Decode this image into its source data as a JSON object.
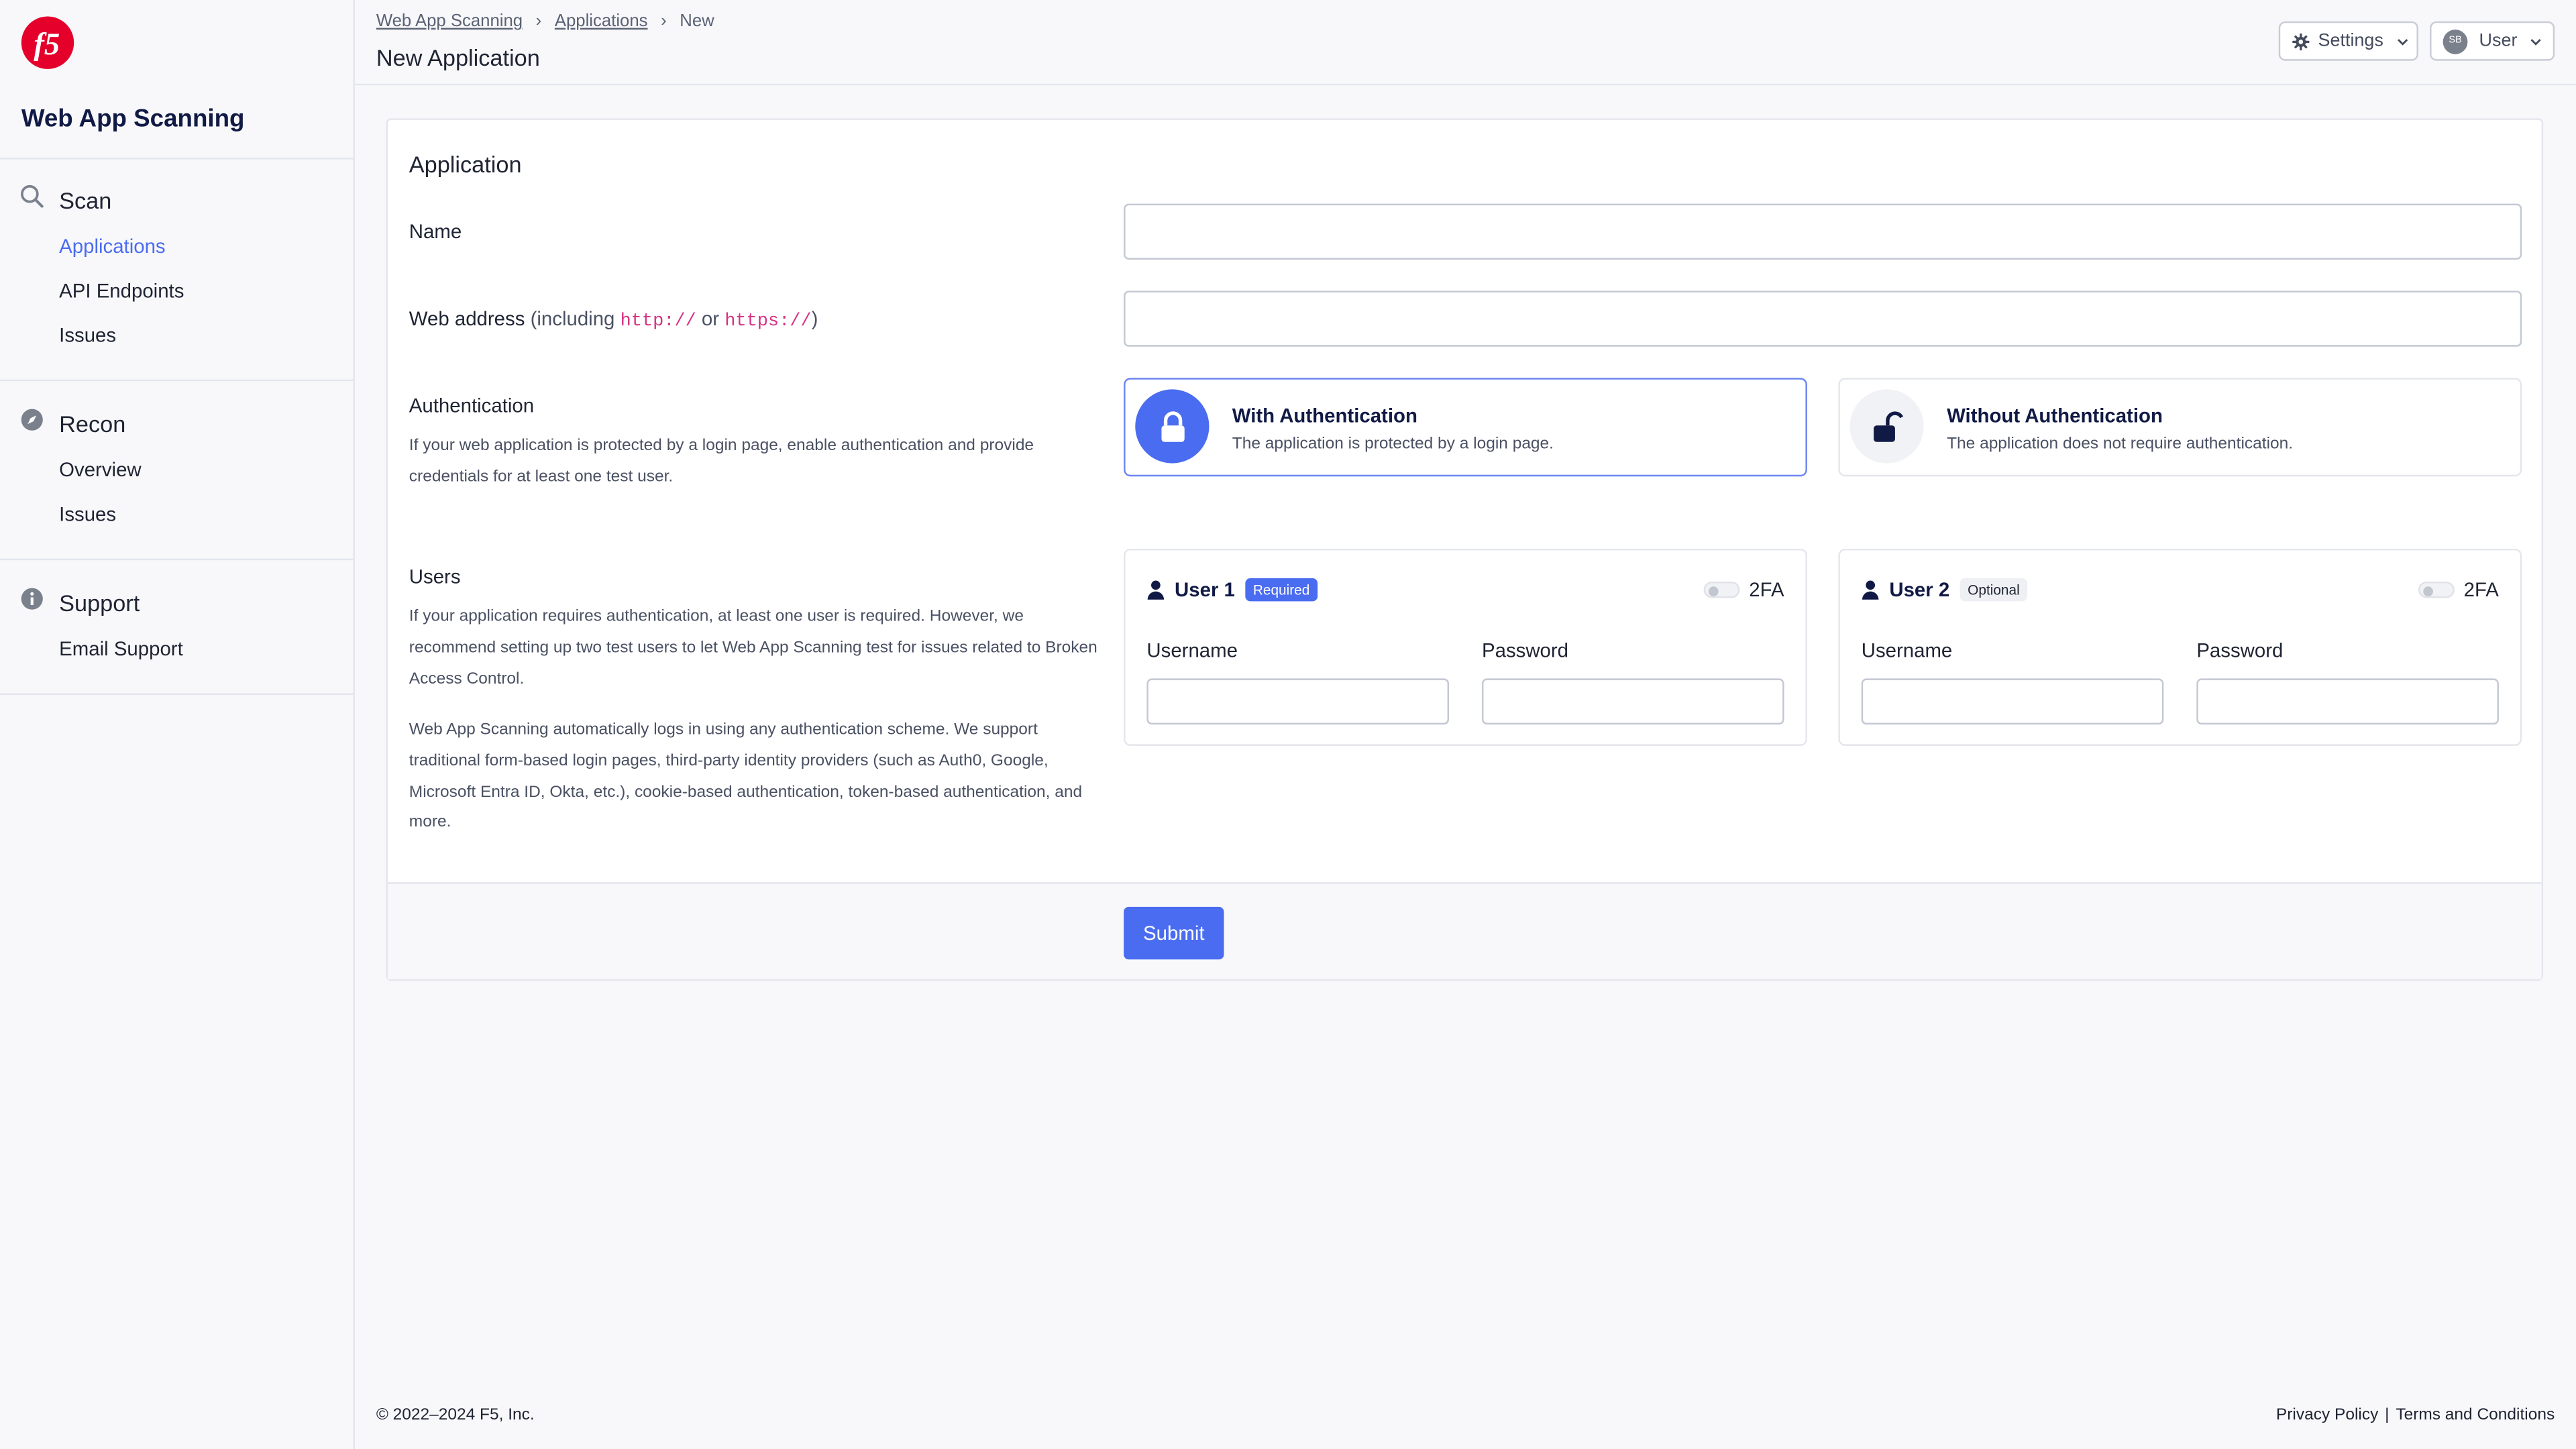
{
  "brand": {
    "logo_text": "f5",
    "app_name": "Web App Scanning"
  },
  "sidebar": {
    "groups": [
      {
        "label": "Scan",
        "icon": "search-icon",
        "items": [
          {
            "label": "Applications",
            "active": true
          },
          {
            "label": "API Endpoints",
            "active": false
          },
          {
            "label": "Issues",
            "active": false
          }
        ]
      },
      {
        "label": "Recon",
        "icon": "compass-icon",
        "items": [
          {
            "label": "Overview",
            "active": false
          },
          {
            "label": "Issues",
            "active": false
          }
        ]
      },
      {
        "label": "Support",
        "icon": "info-icon",
        "items": [
          {
            "label": "Email Support",
            "active": false
          }
        ]
      }
    ]
  },
  "header": {
    "breadcrumbs": [
      "Web App Scanning",
      "Applications",
      "New"
    ],
    "title": "New Application",
    "settings_label": "Settings",
    "user_label": "User",
    "avatar_initials": "SB"
  },
  "form": {
    "section_title": "Application",
    "name_label": "Name",
    "name_value": "",
    "web_address_label": "Web address",
    "web_address_hint_prefix": "(including ",
    "web_address_hint_http": "http://",
    "web_address_hint_or": " or ",
    "web_address_hint_https": "https://",
    "web_address_hint_suffix": ")",
    "web_address_value": "",
    "authentication": {
      "label": "Authentication",
      "help": "If your web application is protected by a login page, enable authentication and provide credentials for at least one test user.",
      "options": [
        {
          "title": "With Authentication",
          "subtitle": "The application is protected by a login page.",
          "selected": true
        },
        {
          "title": "Without Authentication",
          "subtitle": "The application does not require authentication.",
          "selected": false
        }
      ]
    },
    "users": {
      "label": "Users",
      "help1": "If your application requires authentication, at least one user is required. However, we recommend setting up two test users to let Web App Scanning test for issues related to Broken Access Control.",
      "help2": "Web App Scanning automatically logs in using any authentication scheme. We support traditional form-based login pages, third-party identity providers (such as Auth0, Google, Microsoft Entra ID, Okta, etc.), cookie-based authentication, token-based authentication, and more.",
      "cards": [
        {
          "name": "User 1",
          "badge": "Required",
          "twofa_label": "2FA",
          "username_label": "Username",
          "password_label": "Password",
          "username_value": "",
          "password_value": ""
        },
        {
          "name": "User 2",
          "badge": "Optional",
          "twofa_label": "2FA",
          "username_label": "Username",
          "password_label": "Password",
          "username_value": "",
          "password_value": ""
        }
      ]
    },
    "submit_label": "Submit"
  },
  "footer": {
    "copyright": "© 2022–2024 F5, Inc.",
    "privacy": "Privacy Policy",
    "pipe": "|",
    "terms": "Terms and Conditions"
  },
  "colors": {
    "accent": "#4a6cf0",
    "brand_red": "#e4002b",
    "navy": "#111a45"
  }
}
